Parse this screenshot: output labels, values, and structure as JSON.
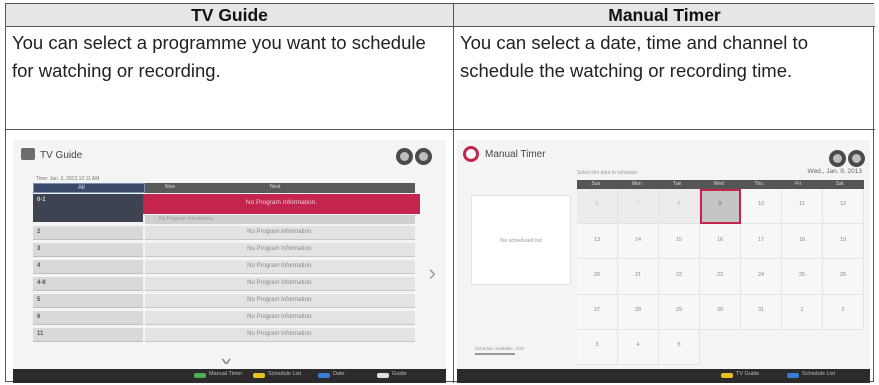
{
  "table": {
    "col1_header": "TV Guide",
    "col2_header": "Manual Timer",
    "col1_text": "You can select a programme you want to schedule for watching or recording.",
    "col2_text": "You can select a date, time and channel to schedule the watching or recording time."
  },
  "tv_guide": {
    "title": "TV Guide",
    "date": "Time: Jan. 3, 2013 12:11 AM",
    "tab_label": "All",
    "col_now": "Now",
    "col_next": "Next",
    "highlight_channel": "0-1",
    "highlight_program": "No Program Information.",
    "sub_program": "No Program Information.",
    "channels": [
      "2",
      "3",
      "4",
      "4-8",
      "5",
      "6",
      "11"
    ],
    "program_text": "No Program Information.",
    "footer": [
      "Manual Timer",
      "Schedule List",
      "Date",
      "Guide"
    ]
  },
  "manual_timer": {
    "title": "Manual Timer",
    "caption": "Select the date to schedule.",
    "date_display": "Wed., Jan. 9, 2013",
    "empty_text": "No scheduled list",
    "weekdays": [
      "Sun",
      "Mon",
      "Tue",
      "Wed",
      "Thu",
      "Fri",
      "Sat"
    ],
    "days": [
      "6",
      "7",
      "8",
      "9",
      "10",
      "11",
      "12",
      "13",
      "14",
      "15",
      "16",
      "17",
      "18",
      "19",
      "20",
      "21",
      "22",
      "23",
      "24",
      "25",
      "26",
      "27",
      "28",
      "29",
      "30",
      "31",
      "1",
      "2",
      "3",
      "4",
      "5"
    ],
    "selected_day": "9",
    "slider_label": "Schedule available: 2/20",
    "slider_sub": "Recording",
    "footer": [
      "TV Guide",
      "Schedule List"
    ]
  },
  "colors": {
    "accent": "#c4244d",
    "dark": "#2b2b2b",
    "footer_green": "#4caf50",
    "footer_yellow": "#e8c020",
    "footer_blue": "#3a7bd5"
  }
}
